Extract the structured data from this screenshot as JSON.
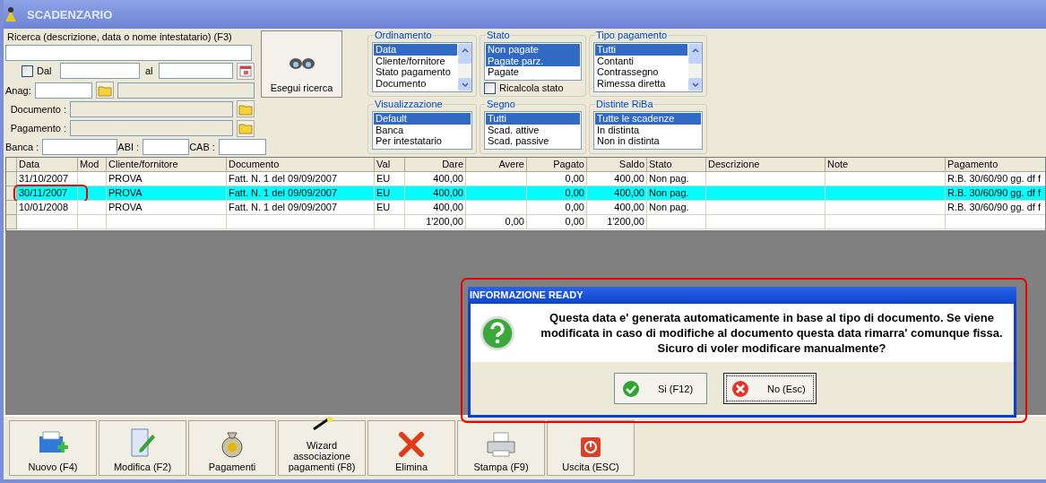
{
  "window": {
    "title": "SCADENZARIO"
  },
  "search": {
    "label": "Ricerca (descrizione, data o nome intestatario) (F3)"
  },
  "date_filter": {
    "checked": false,
    "from_label": "Dal",
    "to_label": "al"
  },
  "anag": {
    "label": "Anag:"
  },
  "document": {
    "label": "Documento :"
  },
  "payment": {
    "label": "Pagamento :"
  },
  "bank": {
    "label": "Banca :",
    "abi_label": "ABI :",
    "cab_label": "CAB :"
  },
  "search_button": {
    "label": "Esegui ricerca"
  },
  "filters": [
    {
      "title": "Ordinamento",
      "scrollbar": true,
      "items": [
        {
          "label": "Data",
          "selected": true
        },
        {
          "label": "Cliente/fornitore",
          "selected": false
        },
        {
          "label": "Stato pagamento",
          "selected": false
        },
        {
          "label": "Documento",
          "selected": false
        }
      ]
    },
    {
      "title": "Stato",
      "scrollbar": false,
      "items": [
        {
          "label": "Non pagate",
          "selected": true
        },
        {
          "label": "Pagate parz.",
          "selected": true
        },
        {
          "label": "Pagate",
          "selected": false
        }
      ],
      "checkbox": {
        "label": "Ricalcola stato",
        "checked": false
      }
    },
    {
      "title": "Tipo pagamento",
      "scrollbar": true,
      "items": [
        {
          "label": "Tutti",
          "selected": true
        },
        {
          "label": "Contanti",
          "selected": false
        },
        {
          "label": "Contrassegno",
          "selected": false
        },
        {
          "label": "Rimessa diretta",
          "selected": false
        }
      ]
    },
    {
      "title": "Visualizzazione",
      "scrollbar": false,
      "items": [
        {
          "label": "Default",
          "selected": true
        },
        {
          "label": "Banca",
          "selected": false
        },
        {
          "label": "Per intestatario",
          "selected": false
        }
      ]
    },
    {
      "title": "Segno",
      "scrollbar": false,
      "items": [
        {
          "label": "Tutti",
          "selected": true
        },
        {
          "label": "Scad. attive",
          "selected": false
        },
        {
          "label": "Scad. passive",
          "selected": false
        }
      ]
    },
    {
      "title": "Distinte RiBa",
      "scrollbar": false,
      "items": [
        {
          "label": "Tutte le scadenze",
          "selected": true
        },
        {
          "label": "In distinta",
          "selected": false
        },
        {
          "label": "Non in distinta",
          "selected": false
        }
      ]
    }
  ],
  "table": {
    "columns": [
      "Data",
      "Mod",
      "Cliente/fornitore",
      "Documento",
      "Val",
      "Dare",
      "Avere",
      "Pagato",
      "Saldo",
      "Stato",
      "Descrizione",
      "Note",
      "Pagamento"
    ],
    "rows": [
      {
        "selected": false,
        "circled": false,
        "cells": [
          "31/10/2007",
          null,
          "PROVA",
          "Fatt. N. 1 del 09/09/2007",
          "EU",
          "400,00",
          null,
          "0,00",
          "400,00",
          "Non pag.",
          null,
          null,
          "R.B. 30/60/90 gg. df f"
        ]
      },
      {
        "selected": true,
        "circled": true,
        "cells": [
          "30/11/2007",
          null,
          "PROVA",
          "Fatt. N. 1 del 09/09/2007",
          "EU",
          "400,00",
          null,
          "0,00",
          "400,00",
          "Non pag.",
          null,
          null,
          "R.B. 30/60/90 gg. df f"
        ]
      },
      {
        "selected": false,
        "circled": false,
        "cells": [
          "10/01/2008",
          null,
          "PROVA",
          "Fatt. N. 1 del 09/09/2007",
          "EU",
          "400,00",
          null,
          "0,00",
          "400,00",
          "Non pag.",
          null,
          null,
          "R.B. 30/60/90 gg. df f"
        ]
      },
      {
        "selected": false,
        "circled": false,
        "cells": [
          null,
          null,
          null,
          null,
          null,
          "1'200,00",
          "0,00",
          "0,00",
          "1'200,00",
          null,
          null,
          null,
          null
        ]
      }
    ]
  },
  "dialog": {
    "title": "INFORMAZIONE READY",
    "outlined": true,
    "message": "Questa data e' generata automaticamente in base al tipo di documento. Se viene modificata in caso di modifiche al documento questa data rimarra' comunque fissa. Sicuro di voler modificare manualmente?",
    "buttons": [
      {
        "label": "Si (F12)",
        "kind": "ok",
        "focused": false
      },
      {
        "label": "No (Esc)",
        "kind": "cancel",
        "focused": true
      }
    ]
  },
  "toolbar": [
    {
      "label": "Nuovo (F4)",
      "kind": "new"
    },
    {
      "label": "Modifica (F2)",
      "kind": "edit"
    },
    {
      "label": "Pagamenti",
      "kind": "money"
    },
    {
      "label": "Wizard associazione pagamenti (F8)",
      "kind": "wand"
    },
    {
      "label": "Elimina",
      "kind": "delete"
    },
    {
      "label": "Stampa (F9)",
      "kind": "print"
    },
    {
      "label": "Uscita (ESC)",
      "kind": "exit"
    }
  ]
}
